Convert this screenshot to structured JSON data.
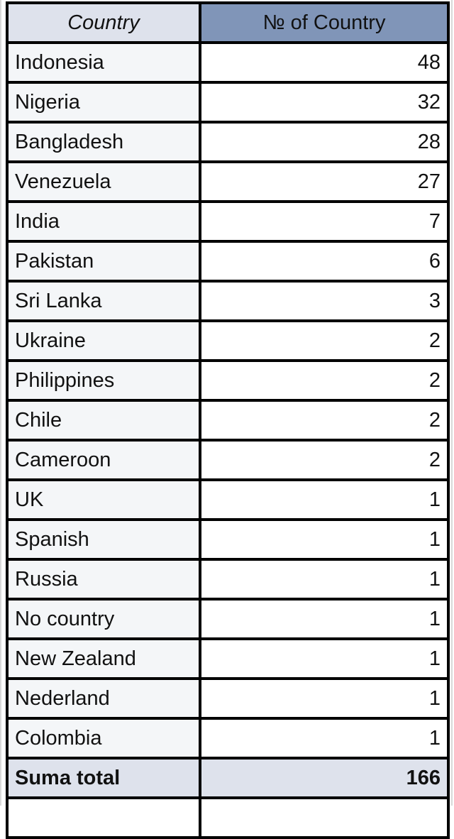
{
  "table": {
    "columns": [
      {
        "key": "country",
        "label": "Country",
        "align": "left"
      },
      {
        "key": "count",
        "label": "№ of Country",
        "align": "right"
      }
    ],
    "header": {
      "country_label": "Country",
      "count_label": "№ of Country"
    },
    "rows": [
      {
        "country": "Indonesia",
        "count": "48"
      },
      {
        "country": "Nigeria",
        "count": "32"
      },
      {
        "country": "Bangladesh",
        "count": "28"
      },
      {
        "country": "Venezuela",
        "count": "27"
      },
      {
        "country": "India",
        "count": "7"
      },
      {
        "country": "Pakistan",
        "count": "6"
      },
      {
        "country": "Sri Lanka",
        "count": "3"
      },
      {
        "country": "Ukraine",
        "count": "2"
      },
      {
        "country": "Philippines",
        "count": "2"
      },
      {
        "country": "Chile",
        "count": "2"
      },
      {
        "country": "Cameroon",
        "count": "2"
      },
      {
        "country": "UK",
        "count": "1"
      },
      {
        "country": "Spanish",
        "count": "1"
      },
      {
        "country": "Russia",
        "count": "1"
      },
      {
        "country": "No country",
        "count": "1"
      },
      {
        "country": "New Zealand",
        "count": "1"
      },
      {
        "country": "Nederland",
        "count": "1"
      },
      {
        "country": "Colombia",
        "count": "1"
      }
    ],
    "total": {
      "label": "Suma total",
      "value": "166"
    }
  },
  "chart_data": {
    "type": "table",
    "title": "",
    "columns": [
      "Country",
      "№ of Country"
    ],
    "categories": [
      "Indonesia",
      "Nigeria",
      "Bangladesh",
      "Venezuela",
      "India",
      "Pakistan",
      "Sri Lanka",
      "Ukraine",
      "Philippines",
      "Chile",
      "Cameroon",
      "UK",
      "Spanish",
      "Russia",
      "No country",
      "New Zealand",
      "Nederland",
      "Colombia"
    ],
    "values": [
      48,
      32,
      28,
      27,
      7,
      6,
      3,
      2,
      2,
      2,
      2,
      1,
      1,
      1,
      1,
      1,
      1,
      1
    ],
    "total_label": "Suma total",
    "total_value": 166,
    "xlabel": "Country",
    "ylabel": "№ of Country"
  },
  "colors": {
    "header_country_bg": "#dee2ec",
    "header_count_bg": "#8095b8",
    "header_count_text": "#ffffff",
    "cell_country_bg": "#f4f6f8",
    "cell_count_bg": "#ffffff",
    "total_bg": "#dee2ec",
    "border": "#000000",
    "text": "#111111"
  }
}
